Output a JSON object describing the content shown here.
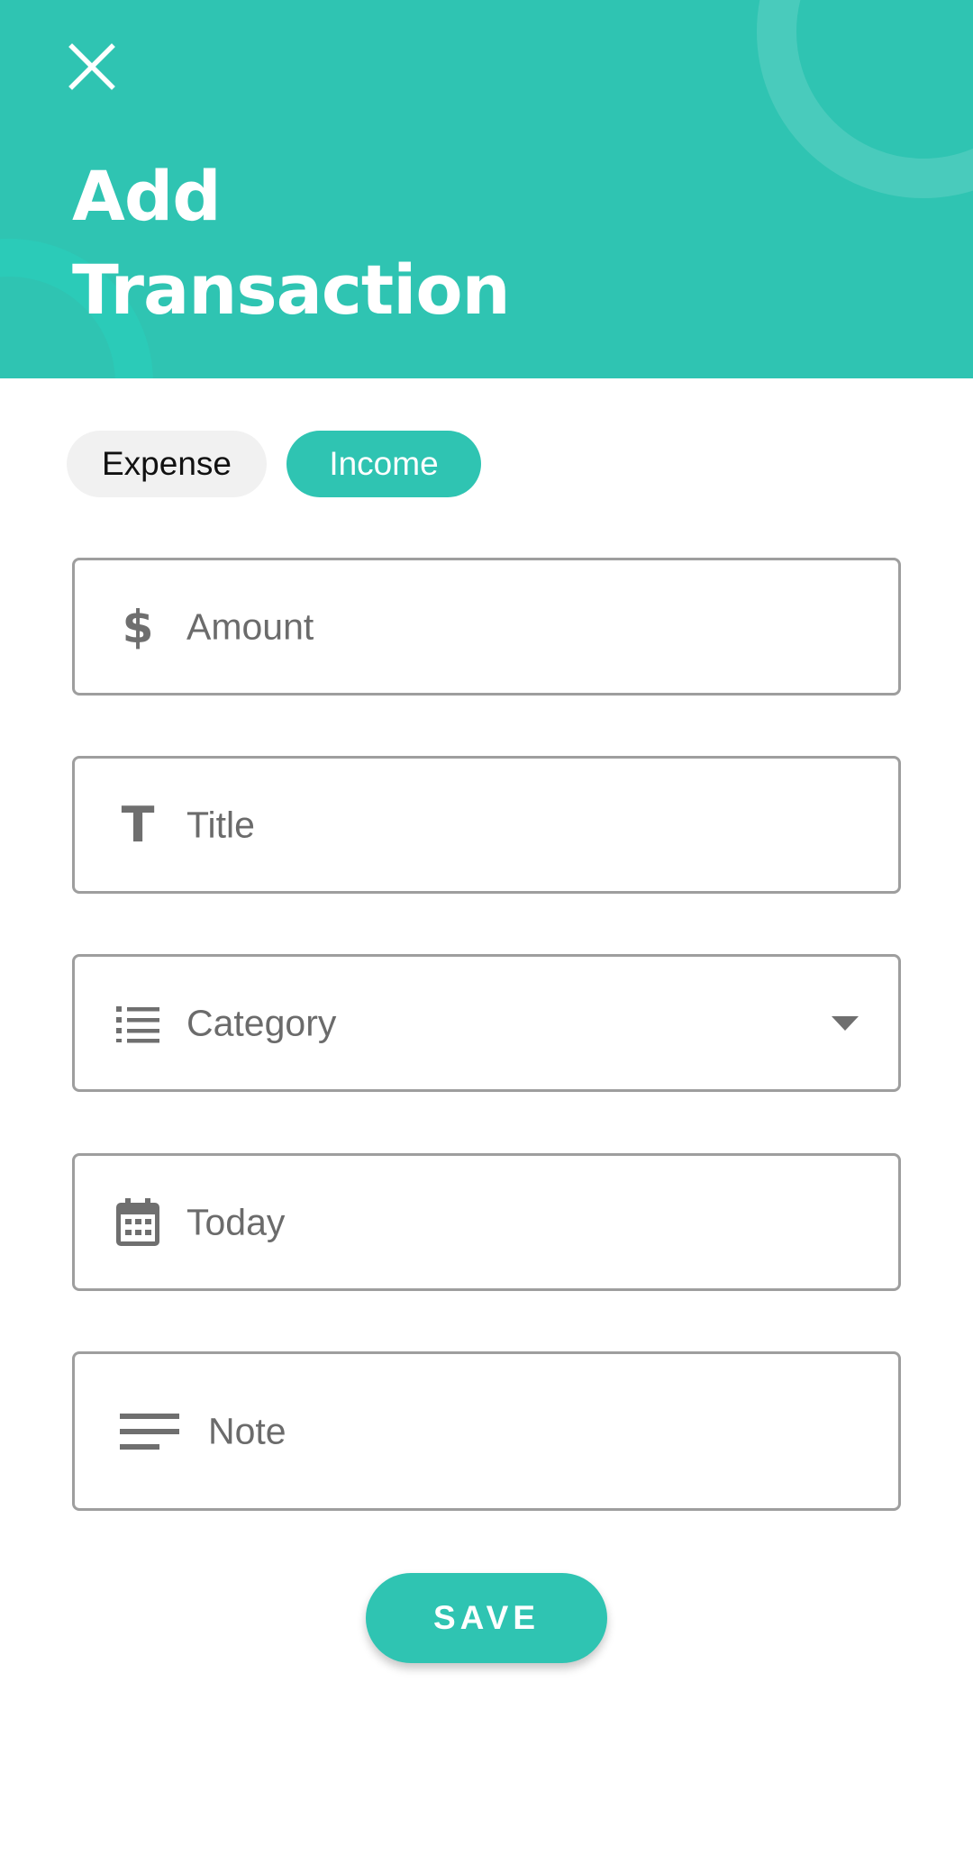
{
  "header": {
    "title_line1": "Add",
    "title_line2": "Transaction",
    "close_icon": "close-icon"
  },
  "type_toggle": {
    "options": [
      {
        "label": "Expense",
        "selected": false
      },
      {
        "label": "Income",
        "selected": true
      }
    ]
  },
  "form": {
    "amount": {
      "placeholder": "Amount",
      "icon": "dollar-icon",
      "icon_glyph": "$"
    },
    "title": {
      "placeholder": "Title",
      "icon": "text-t-icon",
      "icon_glyph": "T"
    },
    "category": {
      "placeholder": "Category",
      "icon": "list-icon",
      "trailing_icon": "dropdown-arrow-icon"
    },
    "date": {
      "value": "Today",
      "icon": "calendar-icon"
    },
    "note": {
      "placeholder": "Note",
      "icon": "notes-icon"
    }
  },
  "save_button": {
    "label": "SAVE"
  },
  "colors": {
    "accent": "#2fc4b2",
    "header_bg": "#2fc4b2",
    "chip_inactive_bg": "#f1f1f1",
    "chip_inactive_text": "#111111",
    "chip_active_text": "#ffffff",
    "border": "#9e9e9e",
    "placeholder_text": "#6b6b6b",
    "icon": "#6f6f6f"
  }
}
